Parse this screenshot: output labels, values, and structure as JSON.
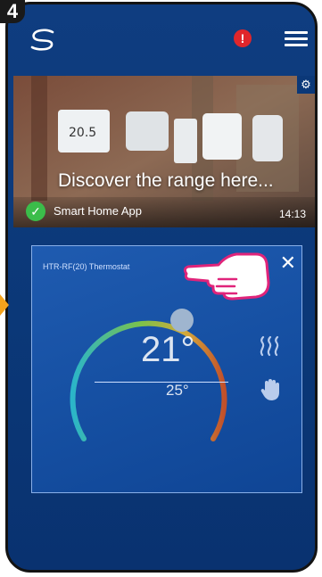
{
  "step": {
    "number": "4"
  },
  "header": {
    "logo_icon": "app-logo-icon",
    "alert_text": "!",
    "menu_icon": "hamburger-menu-icon"
  },
  "banner": {
    "title": "Discover the range here...",
    "app_label": "Smart Home App",
    "time": "14:13",
    "settings_icon": "gear-icon",
    "status_icon": "check-icon"
  },
  "thermostat": {
    "device_name": "HTR-RF(20) Thermostat",
    "current_temp": "21°",
    "set_temp": "25°",
    "close_label": "✕",
    "mode_icons": [
      "heat-wave-icon",
      "hand-icon"
    ]
  },
  "colors": {
    "background": "#0b3878",
    "alert": "#e0262b",
    "accent_gradient_start": "#2bb5c9",
    "accent_gradient_end": "#c1502a"
  }
}
